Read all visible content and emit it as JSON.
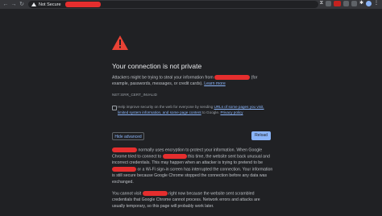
{
  "browser": {
    "security_label": "Not Secure",
    "nav_icons": [
      "←",
      "→",
      "↻"
    ]
  },
  "page": {
    "title": "Your connection is not private",
    "intro_prefix": "Attackers might be trying to steal your information from",
    "intro_suffix": "(for example, passwords, messages, or credit cards).",
    "learn_more": "Learn more",
    "error_code": "NET::ERR_CERT_INVALID",
    "report_prefix": "Help improve security on the web for everyone by sending",
    "report_link": "URLs of some pages you visit, limited system information, and some page content",
    "report_mid": "to Google.",
    "privacy_link": "Privacy policy",
    "hide_advanced": "Hide advanced",
    "reload": "Reload",
    "detail1_a": "normally uses encryption to protect your information. When Google Chrome tried to connect to",
    "detail1_b": "this time, the website sent back unusual and incorrect credentials. This may happen when an attacker is trying to pretend to be",
    "detail1_c": "or a Wi-Fi sign-in screen has interrupted the connection. Your information is still secure because Google Chrome stopped the connection before any data was exchanged.",
    "detail2_a": "You cannot visit",
    "detail2_b": "right now because the website sent scrambled credentials that Google Chrome cannot process. Network errors and attacks are usually temporary, so this page will probably work later."
  },
  "colors": {
    "background": "#202124",
    "accent": "#8ab4f8",
    "warning": "#e94235",
    "redaction": "#e52e2e"
  }
}
